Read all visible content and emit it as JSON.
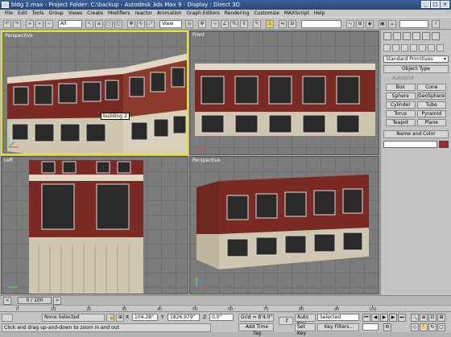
{
  "window": {
    "title": "bldg 2.max - Project Folder: C:\\backup - Autodesk 3ds Max 9 - Display : Direct 3D"
  },
  "menu": [
    "File",
    "Edit",
    "Tools",
    "Group",
    "Views",
    "Create",
    "Modifiers",
    "reactor",
    "Animation",
    "Graph Editors",
    "Rendering",
    "Customize",
    "MAXScript",
    "Help"
  ],
  "toolbar": {
    "selection_filter": "All",
    "coord_system": "View"
  },
  "viewports": {
    "top_left": "Perspective",
    "top_right": "Front",
    "bottom_left": "Left",
    "bottom_right": "Perspective",
    "tooltip": "building 2"
  },
  "command_panel": {
    "category": "Standard Primitives",
    "object_type_title": "Object Type",
    "autogrid": "AutoGrid",
    "objects": [
      "Box",
      "Cone",
      "Sphere",
      "GeoSphere",
      "Cylinder",
      "Tube",
      "Torus",
      "Pyramid",
      "Teapot",
      "Plane"
    ],
    "name_color_title": "Name and Color"
  },
  "timeline": {
    "frame": "0 / 100",
    "ticks": [
      "0",
      "10",
      "20",
      "30",
      "40",
      "50",
      "60",
      "70",
      "80",
      "90",
      "100"
    ]
  },
  "status": {
    "selection": "None Selected",
    "prompt": "Click and drag up-and-down to zoom in and out",
    "x_value": "104.28\"",
    "y_value": "1826.979\"",
    "z_value": "0.0\"",
    "grid": "Grid = 8'4.0\"",
    "add_time_tag": "Add Time Tag",
    "auto_key": "Auto Key",
    "set_key": "Set Key",
    "key_mode": "Selected",
    "key_filters": "Key Filters...",
    "x_label": "X",
    "y_label": "Y",
    "z_label": "Z"
  },
  "colors": {
    "active_viewport": "#e6e21e",
    "brick": "#7a2a22",
    "stone": "#cfc6b0",
    "object_color": "#9a2b2b"
  }
}
